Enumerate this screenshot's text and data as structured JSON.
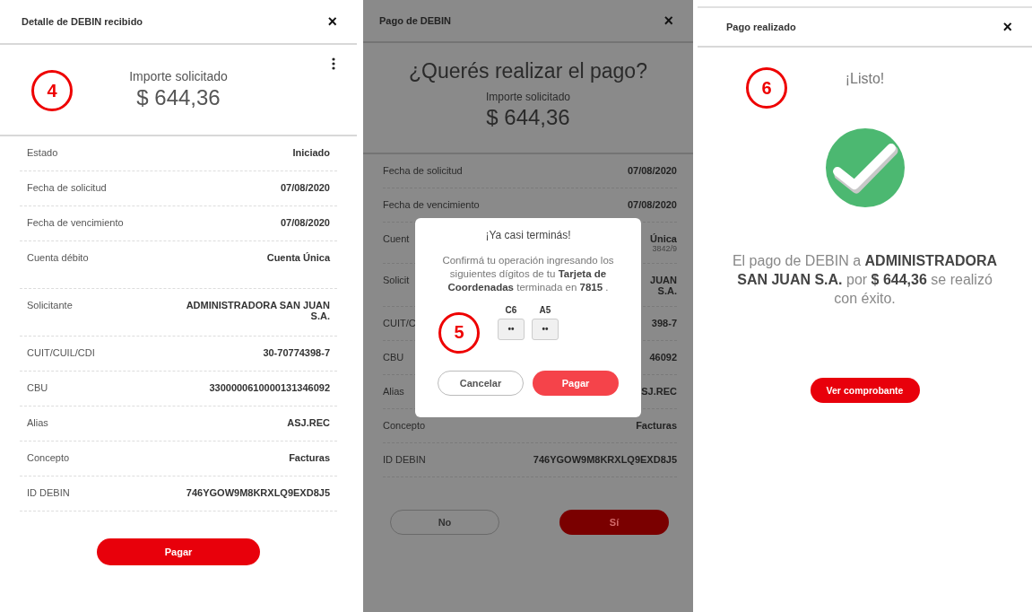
{
  "detail_panel": {
    "title": "Detalle de DEBIN recibido",
    "close": "×",
    "step_badge": "4",
    "amount_label": "Importe solicitado",
    "amount": "$ 644,36",
    "rows": [
      {
        "label": "Estado",
        "value": "Iniciado",
        "tall": false
      },
      {
        "label": "Fecha de solicitud",
        "value": "07/08/2020",
        "tall": false
      },
      {
        "label": "Fecha de vencimiento",
        "value": "07/08/2020",
        "tall": false
      },
      {
        "label": "Cuenta débito",
        "value": "Cuenta Única",
        "tall": true
      },
      {
        "label": "Solicitante",
        "value": "ADMINISTRADORA SAN JUAN S.A.",
        "tall": true
      },
      {
        "label": "CUIT/CUIL/CDI",
        "value": "30-70774398-7",
        "tall": false
      },
      {
        "label": "CBU",
        "value": "3300000610000131346092",
        "tall": false
      },
      {
        "label": "Alias",
        "value": "ASJ.REC",
        "tall": false
      },
      {
        "label": "Concepto",
        "value": "Facturas",
        "tall": false
      },
      {
        "label": "ID DEBIN",
        "value": "746YGOW9M8KRXLQ9EXD8J5",
        "tall": false
      }
    ],
    "button": "Pagar"
  },
  "payment_panel": {
    "title": "Pago de DEBIN",
    "close": "×",
    "question": "¿Querés realizar el pago?",
    "amount_label": "Importe solicitado",
    "amount": "$ 644,36",
    "rows": [
      {
        "label": "Fecha de solicitud",
        "value": "07/08/2020"
      },
      {
        "label": "Fecha de vencimiento",
        "value": "07/08/2020"
      },
      {
        "label": "Cuent",
        "value": "Única",
        "detail": "3842/9"
      },
      {
        "label": "Solicit",
        "value": "JUAN S.A."
      },
      {
        "label": "CUIT/C",
        "value": "398-7"
      },
      {
        "label": "CBU",
        "value": "46092"
      },
      {
        "label": "Alias",
        "value": "SJ.REC"
      },
      {
        "label": "Concepto",
        "value": "Facturas"
      },
      {
        "label": "ID DEBIN",
        "value": "746YGOW9M8KRXLQ9EXD8J5"
      }
    ],
    "buttons": [
      {
        "label": "No",
        "kind": "outline"
      },
      {
        "label": "Sí",
        "kind": "filled"
      }
    ],
    "dialog": {
      "title": "¡Ya casi terminás!",
      "text": "Confirmá tu operación ingresando los siguientes dígitos de tu **Tarjeta de Coordenadas** terminada en **7815** .",
      "step_badge": "5",
      "code_fields": [
        {
          "label": "C6",
          "value": "••"
        },
        {
          "label": "A5",
          "value": "••"
        }
      ],
      "buttons": [
        {
          "label": "Cancelar",
          "kind": "outline"
        },
        {
          "label": "Pagar",
          "kind": "filled"
        }
      ]
    }
  },
  "success_panel": {
    "title": "Pago realizado",
    "close": "×",
    "step_badge": "6",
    "heading": "¡Listo!",
    "message": "El pago de DEBIN a **ADMINISTRADORA SAN JUAN S.A.** por **$ 644,36** se realizó con éxito.",
    "button": "Ver comprobante"
  }
}
